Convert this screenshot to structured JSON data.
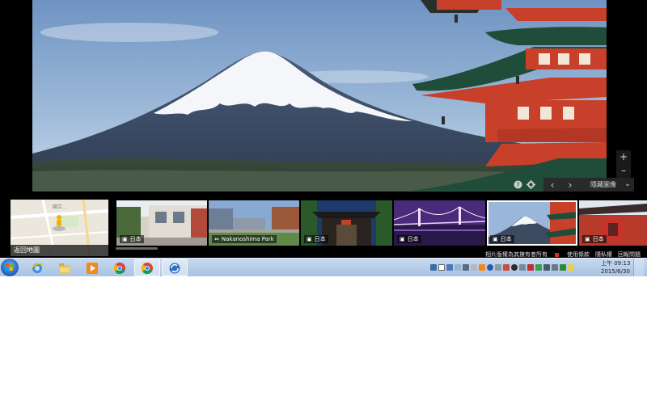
{
  "viewer": {
    "zoom_in": "+",
    "zoom_out": "–",
    "help_icon": "question-icon",
    "settings_icon": "gear-icon",
    "prev": "‹",
    "next": "›",
    "hide_images": "隱藏圖像",
    "collapse": "⌄"
  },
  "map_thumb": {
    "label": "國立…",
    "back_to_map": "返回地圖"
  },
  "thumbnails": [
    {
      "caption": "日本",
      "icon": "camera-icon"
    },
    {
      "caption": "Nakanoshima Park",
      "icon": "panorama-icon"
    },
    {
      "caption": "日本",
      "icon": "camera-icon"
    },
    {
      "caption": "日本",
      "icon": "camera-icon"
    },
    {
      "caption": "日本",
      "icon": "camera-icon"
    },
    {
      "caption": "日本",
      "icon": "camera-icon"
    }
  ],
  "footer": {
    "copyright": "相片版權為其擁有者所有",
    "terms": "使用條款",
    "privacy": "隱私權",
    "report": "回報問題"
  },
  "clock": {
    "time": "上午 09:13",
    "date": "2015/6/30"
  },
  "colors": {
    "sky_top": "#7f9ec4",
    "sky_bottom": "#c6d8ea",
    "pagoda_red": "#c9402a",
    "pagoda_roof": "#1f4d3a",
    "taskbar": "#b4cbe6"
  }
}
